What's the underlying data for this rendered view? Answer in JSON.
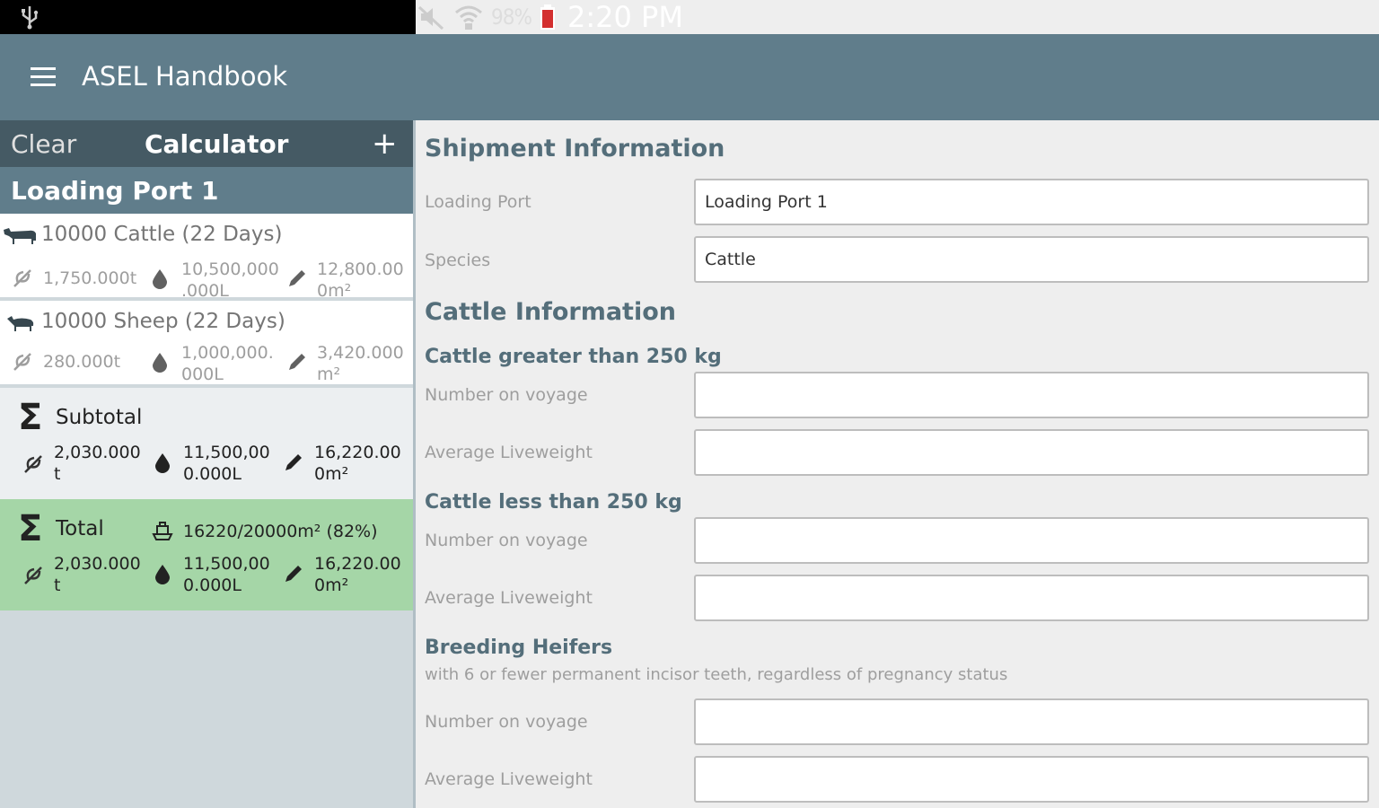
{
  "status_bar": {
    "battery": "98%",
    "time": "2:20 PM",
    "icons": [
      "usb-icon",
      "mute-icon",
      "wifi-icon",
      "battery-icon"
    ]
  },
  "app_bar": {
    "title": "ASEL Handbook",
    "menu_icon": "hamburger-menu-icon",
    "color": "#607d8b"
  },
  "calculator": {
    "clear_label": "Clear",
    "title": "Calculator",
    "add_label": "+",
    "port_name": "Loading Port 1",
    "items": [
      {
        "title": "10000 Cattle (22 Days)",
        "animal_icon": "cattle-icon",
        "fodder": "1,750.000t",
        "water": "10,500,000\n.000L",
        "area": "12,800.00\n0m²"
      },
      {
        "title": "10000 Sheep (22 Days)",
        "animal_icon": "sheep-icon",
        "fodder": "280.000t",
        "water": "1,000,000.\n000L",
        "area": "3,420.000\nm²"
      }
    ],
    "subtotal": {
      "label": "Subtotal",
      "fodder": "2,030.000\nt",
      "water": "11,500,00\n0.000L",
      "area": "16,220.00\n0m²"
    },
    "total": {
      "label": "Total",
      "capacity": "16220/20000m² (82%)",
      "fodder": "2,030.000\nt",
      "water": "11,500,00\n0.000L",
      "area": "16,220.00\n0m²",
      "color": "#a5d6a7"
    }
  },
  "form": {
    "shipment_heading": "Shipment Information",
    "loading_port_label": "Loading Port",
    "loading_port_value": "Loading Port 1",
    "species_label": "Species",
    "species_value": "Cattle",
    "cattle_heading": "Cattle Information",
    "group1_heading": "Cattle greater than 250 kg",
    "group2_heading": "Cattle less than 250 kg",
    "group3_heading": "Breeding Heifers",
    "group3_note": "with 6 or fewer permanent incisor teeth, regardless of pregnancy status",
    "number_label": "Number on voyage",
    "weight_label": "Average Liveweight",
    "g1_number": "",
    "g1_weight": "",
    "g2_number": "",
    "g2_weight": "",
    "g3_number": "",
    "g3_weight": ""
  }
}
